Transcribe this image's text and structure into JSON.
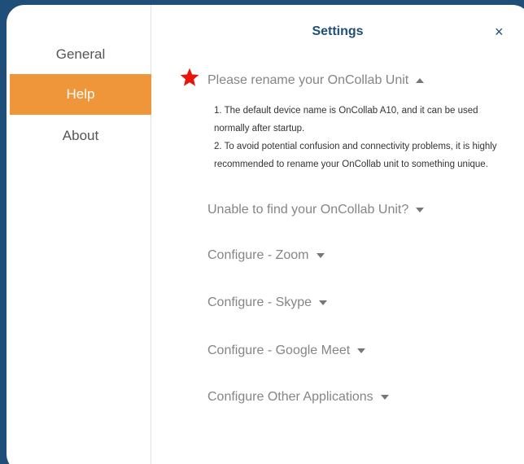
{
  "window": {
    "title": "Settings"
  },
  "sidebar": {
    "items": [
      {
        "label": "General",
        "active": false
      },
      {
        "label": "Help",
        "active": true
      },
      {
        "label": "About",
        "active": false
      }
    ]
  },
  "header": {
    "close_glyph": "×"
  },
  "faq": {
    "items": [
      {
        "question": "Please rename your OnCollab Unit",
        "expanded": true,
        "icon": "star-icon",
        "answer": "1. The default device name is OnCollab A10, and it can be used normally after startup.\n2. To avoid potential confusion and connectivity problems, it is highly recommended to rename your OnCollab unit to something unique."
      },
      {
        "question": "Unable to find your OnCollab Unit?",
        "expanded": false
      },
      {
        "question": "Configure - Zoom",
        "expanded": false
      },
      {
        "question": "Configure - Skype",
        "expanded": false
      },
      {
        "question": "Configure - Google Meet",
        "expanded": false
      },
      {
        "question": "Configure Other Applications",
        "expanded": false
      }
    ]
  },
  "colors": {
    "accent": "#f0963a",
    "brand": "#1f4e79",
    "star": "#e8140c",
    "muted_text": "#858585"
  }
}
